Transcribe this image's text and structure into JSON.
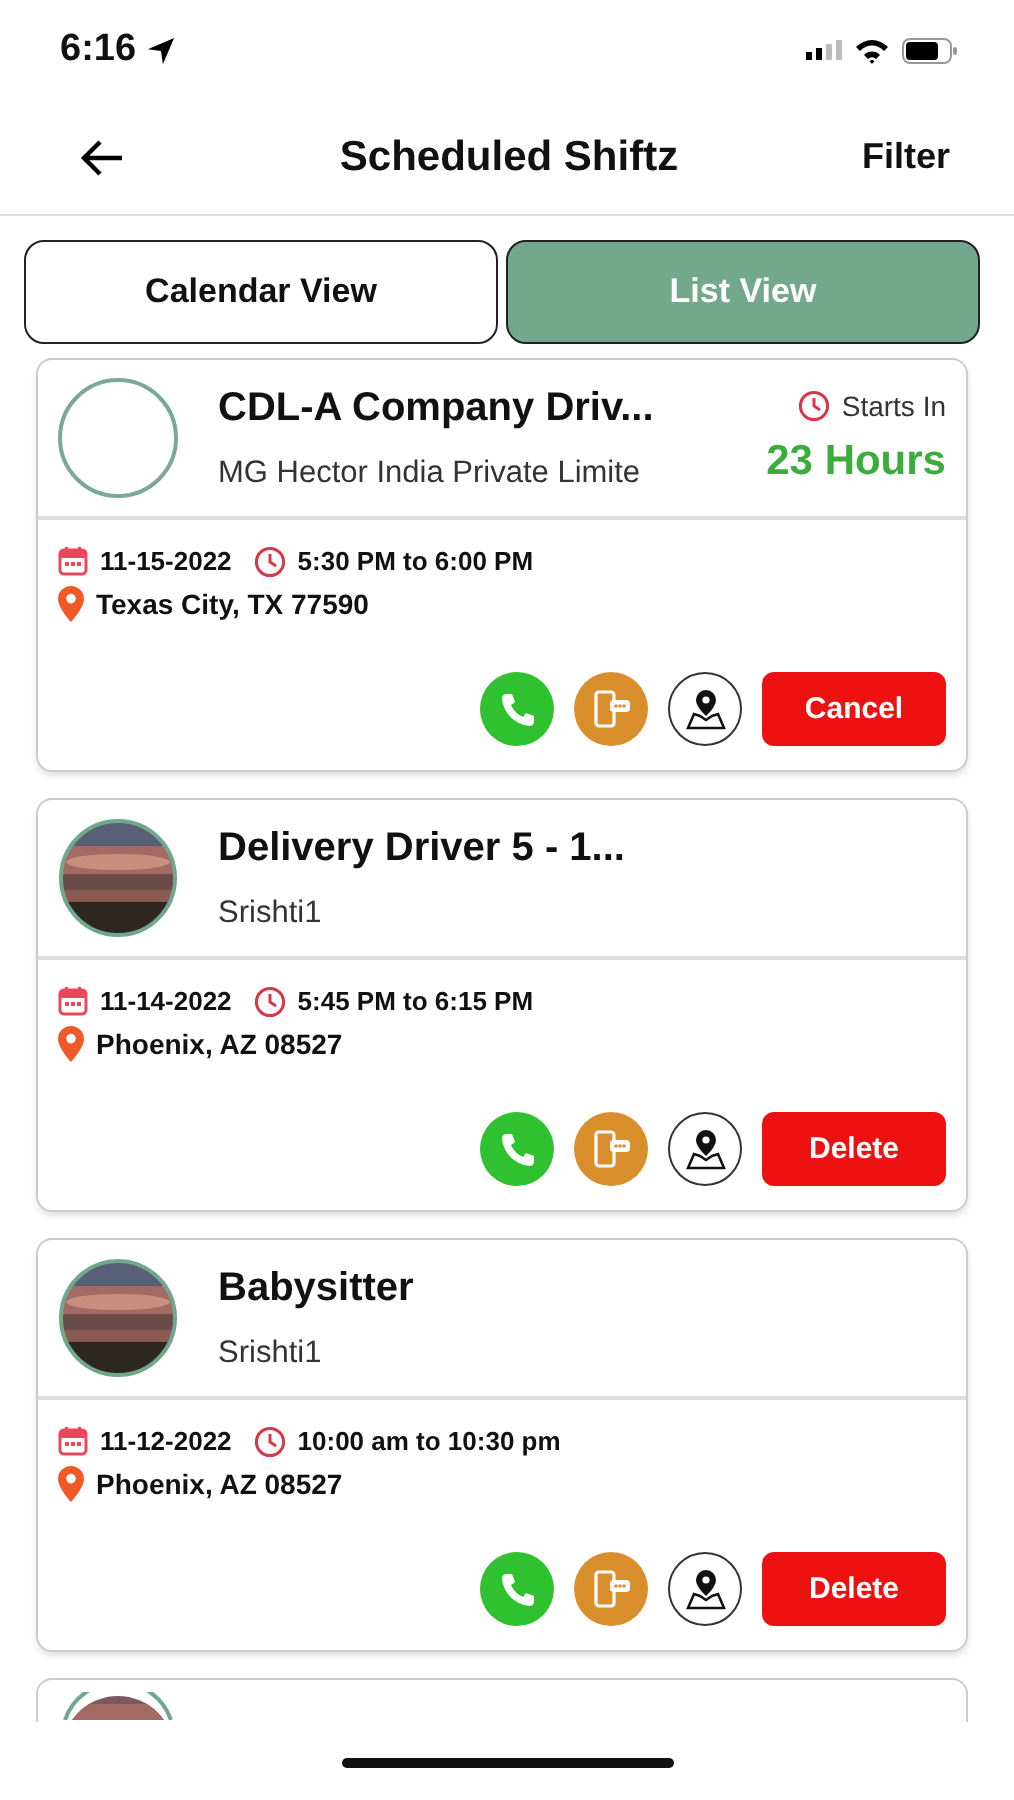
{
  "status_bar": {
    "time": "6:16"
  },
  "header": {
    "title": "Scheduled Shiftz",
    "action": "Filter"
  },
  "tabs": [
    {
      "label": "Calendar View",
      "selected": false
    },
    {
      "label": "List View",
      "selected": true
    }
  ],
  "shifts": [
    {
      "title": "CDL-A Company Driv...",
      "company": "MG Hector India Private Limite",
      "has_photo": false,
      "starts_in": {
        "label": "Starts In",
        "value": "23 Hours"
      },
      "date": "11-15-2022",
      "time": "5:30 PM to 6:00 PM",
      "location": "Texas City, TX 77590",
      "action": "Cancel"
    },
    {
      "title": "Delivery Driver 5 - 1...",
      "company": "Srishti1",
      "has_photo": true,
      "date": "11-14-2022",
      "time": "5:45 PM to 6:15 PM",
      "location": "Phoenix, AZ 08527",
      "action": "Delete"
    },
    {
      "title": "Babysitter",
      "company": "Srishti1",
      "has_photo": true,
      "date": "11-12-2022",
      "time": "10:00 am to 10:30 pm",
      "location": "Phoenix, AZ 08527",
      "action": "Delete"
    }
  ]
}
